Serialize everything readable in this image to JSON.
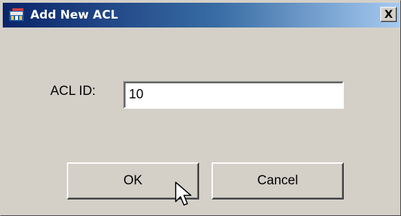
{
  "window": {
    "title": "Add New ACL",
    "close_label": "X",
    "icon": "acl-app-icon"
  },
  "form": {
    "acl_id_label": "ACL ID:",
    "acl_id_value": "10"
  },
  "buttons": {
    "ok_label": "OK",
    "cancel_label": "Cancel"
  },
  "colors": {
    "titlebar_start": "#0a246a",
    "titlebar_end": "#a6caf0",
    "dialog_background": "#d4d0c8"
  }
}
